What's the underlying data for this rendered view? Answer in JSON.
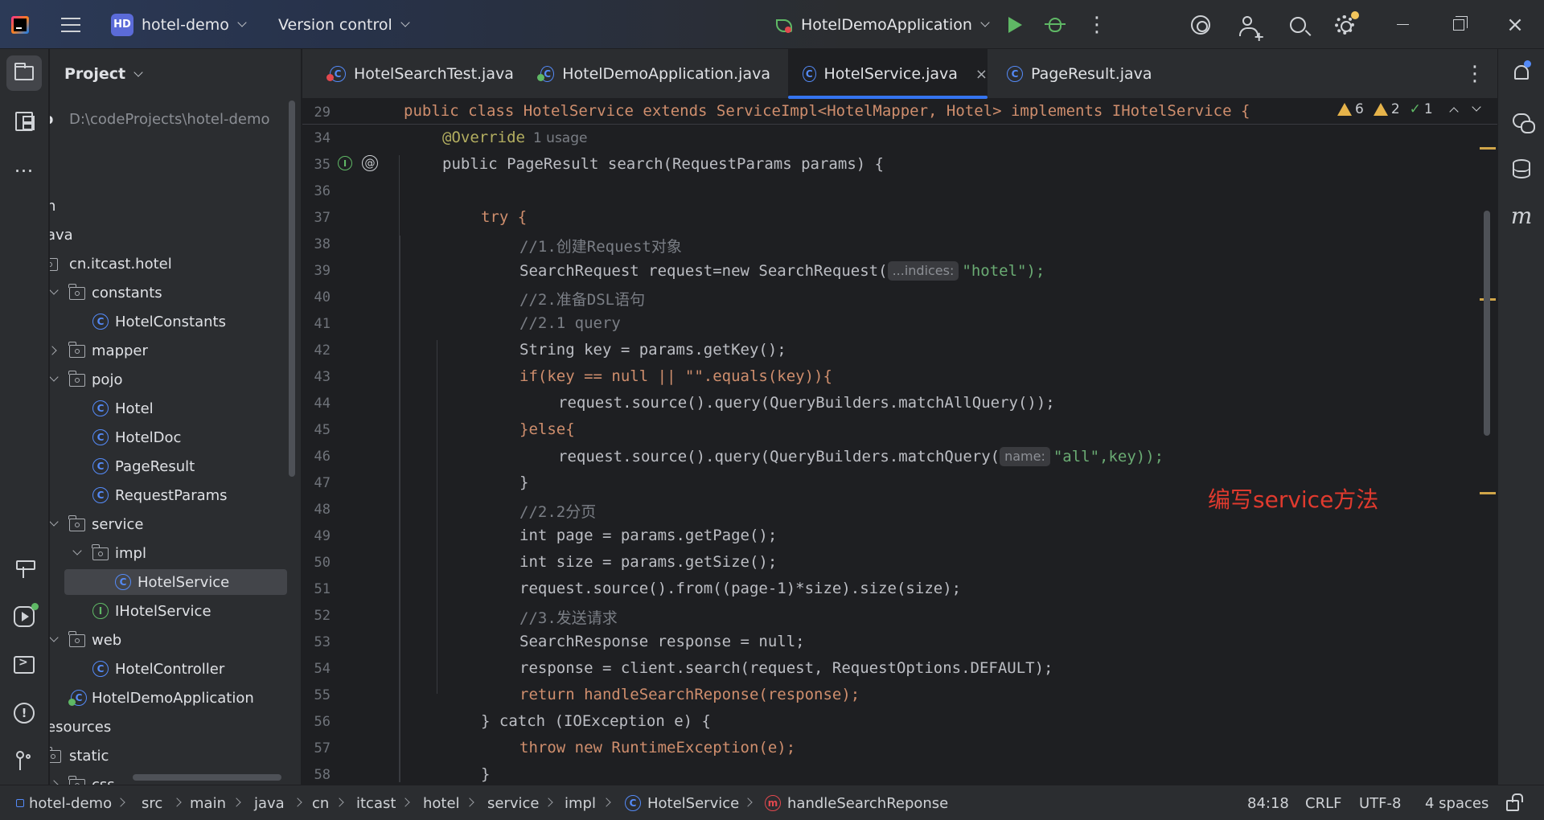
{
  "titlebar": {
    "project_badge": "HD",
    "project_name": "hotel-demo",
    "version_control": "Version control",
    "run_config": "HotelDemoApplication"
  },
  "project_panel": {
    "title": "Project",
    "tree": [
      {
        "label": "o",
        "path": "D:\\codeProjects\\hotel-demo"
      },
      {
        "label": "n"
      },
      {
        "label": "ava"
      },
      {
        "label": "cn.itcast.hotel"
      },
      {
        "label": "constants"
      },
      {
        "label": "HotelConstants"
      },
      {
        "label": "mapper"
      },
      {
        "label": "pojo"
      },
      {
        "label": "Hotel"
      },
      {
        "label": "HotelDoc"
      },
      {
        "label": "PageResult"
      },
      {
        "label": "RequestParams"
      },
      {
        "label": "service"
      },
      {
        "label": "impl"
      },
      {
        "label": "HotelService"
      },
      {
        "label": "IHotelService"
      },
      {
        "label": "web"
      },
      {
        "label": "HotelController"
      },
      {
        "label": "HotelDemoApplication"
      },
      {
        "label": "esources"
      },
      {
        "label": "static"
      },
      {
        "label": "css"
      }
    ]
  },
  "tabs": [
    {
      "label": "HotelSearchTest.java"
    },
    {
      "label": "HotelDemoApplication.java"
    },
    {
      "label": "HotelService.java",
      "active": true,
      "close": "×"
    },
    {
      "label": "PageResult.java"
    }
  ],
  "editor": {
    "inspections": {
      "warnings": "6",
      "weak_warnings": "2",
      "typos": "1"
    },
    "overlay_note": "编写service方法",
    "line_numbers": [
      "29",
      "34",
      "35",
      "36",
      "37",
      "38",
      "39",
      "40",
      "41",
      "42",
      "43",
      "44",
      "45",
      "46",
      "47",
      "48",
      "49",
      "50",
      "51",
      "52",
      "53",
      "54",
      "55",
      "56",
      "57",
      "58"
    ],
    "lines": {
      "l29": "public class HotelService extends ServiceImpl<HotelMapper, Hotel> implements IHotelService {",
      "l34_ann": "@Override",
      "l34_usage": "1 usage",
      "l35": "public PageResult search(RequestParams params) {",
      "l37": "try {",
      "l38": "//1.创建Request对象",
      "l39_a": "SearchRequest request=new SearchRequest(",
      "l39_hint": "...indices:",
      "l39_b": "\"hotel\");",
      "l40": "//2.准备DSL语句",
      "l41": "//2.1 query",
      "l42": "String key = params.getKey();",
      "l43": "if(key == null || \"\".equals(key)){",
      "l44": "request.source().query(QueryBuilders.matchAllQuery());",
      "l45": "}else{",
      "l46_a": "request.source().query(QueryBuilders.matchQuery(",
      "l46_hint": "name:",
      "l46_b": "\"all\",key));",
      "l47": "}",
      "l48": "//2.2分页",
      "l49": "int page = params.getPage();",
      "l50": "int size = params.getSize();",
      "l51": "request.source().from((page-1)*size).size(size);",
      "l52": "//3.发送请求",
      "l53": "SearchResponse response = null;",
      "l54": "response = client.search(request, RequestOptions.DEFAULT);",
      "l55": "return handleSearchReponse(response);",
      "l56": "} catch (IOException e) {",
      "l57": "throw new RuntimeException(e);",
      "l58": "}"
    }
  },
  "statusbar": {
    "breadcrumbs": [
      "hotel-demo",
      "src",
      "main",
      "java",
      "cn",
      "itcast",
      "hotel",
      "service",
      "impl",
      "HotelService",
      "handleSearchReponse"
    ],
    "position": "84:18",
    "line_sep": "CRLF",
    "encoding": "UTF-8",
    "indent": "4 spaces"
  },
  "colors": {
    "editor_bg": "#1e1f22",
    "panel_bg": "#2b2d30",
    "accent": "#3574f0",
    "keyword": "#cf8e6d",
    "string": "#6aab73",
    "comment": "#7a7e85",
    "function": "#56a8f5",
    "note_red": "#e03a2e"
  }
}
